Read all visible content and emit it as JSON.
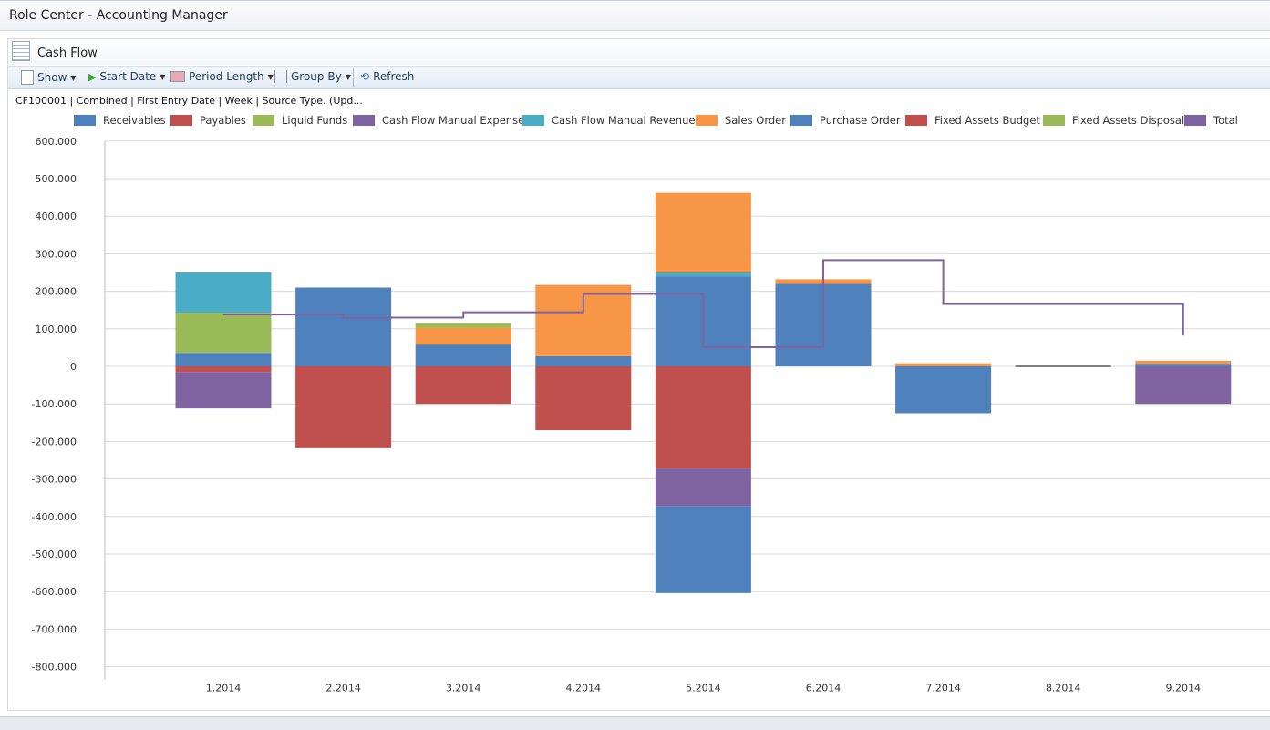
{
  "window": {
    "title": "Role Center - Accounting Manager"
  },
  "part": {
    "title": "Cash Flow",
    "icon": "list-icon"
  },
  "toolbar": {
    "show": "Show",
    "start_date": "Start Date",
    "period_length": "Period Length",
    "group_by": "Group By",
    "refresh": "Refresh"
  },
  "status": "CF100001 | Combined | First Entry Date | Week | Source Type.  (Upd...",
  "chart_data": {
    "type": "bar",
    "stacked": true,
    "categories": [
      "1.2014",
      "2.2014",
      "3.2014",
      "4.2014",
      "5.2014",
      "6.2014",
      "7.2014",
      "8.2014",
      "9.2014"
    ],
    "ylim": [
      -800000,
      600000
    ],
    "yticks": [
      600000,
      500000,
      400000,
      300000,
      200000,
      100000,
      0,
      -100000,
      -200000,
      -300000,
      -400000,
      -500000,
      -600000,
      -700000,
      -800000
    ],
    "ytick_labels": [
      "600.000",
      "500.000",
      "400.000",
      "300.000",
      "200.000",
      "100.000",
      "0",
      "-100.000",
      "-200.000",
      "-300.000",
      "-400.000",
      "-500.000",
      "-600.000",
      "-700.000",
      "-800.000"
    ],
    "grid": true,
    "legend_position": "top",
    "series": [
      {
        "name": "Receivables",
        "color": "#4f81bd",
        "values": [
          36000,
          210000,
          58000,
          27000,
          240000,
          220000,
          0,
          0,
          7000
        ]
      },
      {
        "name": "Payables",
        "color": "#c0504d",
        "values": [
          -15000,
          -218000,
          -100000,
          -170000,
          -272000,
          0,
          0,
          0,
          0
        ]
      },
      {
        "name": "Liquid Funds",
        "color": "#9bbb59",
        "values": [
          107000,
          0,
          0,
          0,
          0,
          0,
          0,
          0,
          0
        ]
      },
      {
        "name": "Cash Flow Manual Expense",
        "color": "#8064a2",
        "values": [
          -97000,
          0,
          0,
          0,
          -100000,
          0,
          0,
          0,
          -100000
        ]
      },
      {
        "name": "Cash Flow Manual Revenue",
        "color": "#4bacc6",
        "values": [
          107000,
          0,
          0,
          0,
          10000,
          0,
          0,
          0,
          0
        ]
      },
      {
        "name": "Sales Order",
        "color": "#f79646",
        "values": [
          0,
          0,
          45000,
          190000,
          212000,
          12000,
          8000,
          0,
          8000
        ]
      },
      {
        "name": "Purchase Order",
        "color": "#4f81bd",
        "values": [
          0,
          0,
          0,
          0,
          -232000,
          0,
          -125000,
          0,
          0
        ]
      },
      {
        "name": "Fixed Assets Budget",
        "color": "#c0504d",
        "values": [
          0,
          0,
          0,
          0,
          0,
          0,
          0,
          0,
          0
        ]
      },
      {
        "name": "Fixed Assets Disposal",
        "color": "#9bbb59",
        "values": [
          0,
          0,
          13000,
          0,
          0,
          0,
          0,
          0,
          0
        ]
      },
      {
        "name": "Total",
        "color": "#8064a2",
        "type": "step-line",
        "values": [
          138000,
          130000,
          144000,
          193000,
          51000,
          283000,
          166000,
          166000,
          82000
        ]
      }
    ]
  }
}
